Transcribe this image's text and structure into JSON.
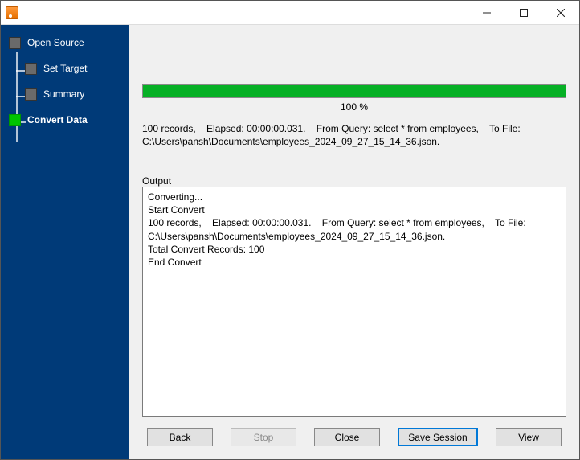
{
  "window": {
    "title": ""
  },
  "sidebar": {
    "items": [
      {
        "label": "Open Source",
        "active": false
      },
      {
        "label": "Set Target",
        "active": false
      },
      {
        "label": "Summary",
        "active": false
      },
      {
        "label": "Convert Data",
        "active": true
      }
    ]
  },
  "progress": {
    "percent": 100,
    "label": "100 %",
    "bar_color": "#06b025"
  },
  "summary_text": "100 records,    Elapsed: 00:00:00.031.    From Query: select * from employees,    To File: C:\\Users\\pansh\\Documents\\employees_2024_09_27_15_14_36.json.",
  "output": {
    "label": "Output",
    "lines": [
      "Converting...",
      "Start Convert",
      "100 records,    Elapsed: 00:00:00.031.    From Query: select * from employees,    To File: C:\\Users\\pansh\\Documents\\employees_2024_09_27_15_14_36.json.",
      "Total Convert Records: 100",
      "End Convert"
    ]
  },
  "buttons": {
    "back": "Back",
    "stop": "Stop",
    "close": "Close",
    "save_session": "Save Session",
    "view": "View"
  }
}
